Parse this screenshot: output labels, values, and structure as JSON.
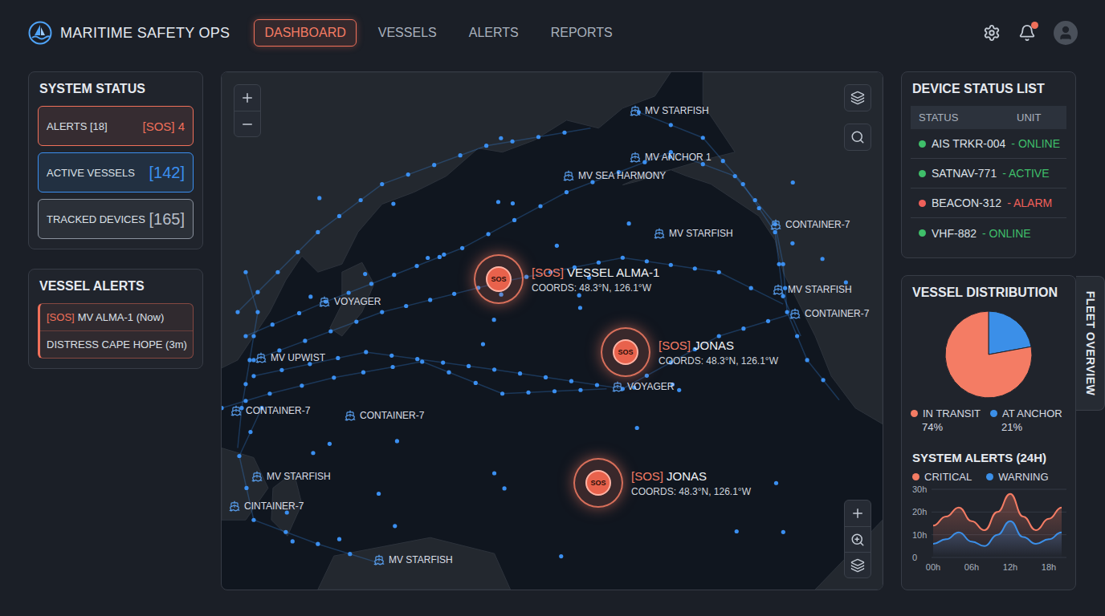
{
  "app": {
    "title": "MARITIME SAFETY OPS"
  },
  "nav": [
    {
      "label": "DASHBOARD",
      "selected": true
    },
    {
      "label": "VESSELS",
      "selected": false
    },
    {
      "label": "ALERTS",
      "selected": false
    },
    {
      "label": "REPORTS",
      "selected": false
    }
  ],
  "header": {
    "notifications_unread": true
  },
  "system_status": {
    "title": "SYSTEM STATUS",
    "items": [
      {
        "kind": "alert",
        "label": "ALERTS [18]",
        "value": "[SOS] 4",
        "color": "#f0705a"
      },
      {
        "kind": "count",
        "label": "ACTIVE VESSELS",
        "value": "[142]",
        "color": "#3b8ff0"
      },
      {
        "kind": "count",
        "label": "TRACKED DEVICES",
        "value": "[165]",
        "color": "#8a929e"
      }
    ]
  },
  "vessel_alerts": {
    "title": "VESSEL ALERTS",
    "items": [
      {
        "tag": "[SOS]",
        "text": "MV ALMA-1 (Now)"
      },
      {
        "text": "DISTRESS CAPE HOPE (3m)"
      }
    ]
  },
  "map": {
    "sos_markers": [
      {
        "icon": "SOS",
        "tag": "[SOS]",
        "name": "VESSEL ALMA-1",
        "coords": "COORDS: 48.3°N, 126.1°W"
      },
      {
        "icon": "SOS",
        "tag": "[SOS]",
        "name": "JONAS",
        "coords": "COORDS: 48.3°N, 126.1°W"
      },
      {
        "icon": "SOS",
        "tag": "[SOS]",
        "name": "JONAS",
        "coords": "COORDS: 48.3°N, 126.1°W"
      }
    ],
    "vessels": [
      {
        "name": "MV STARFISH"
      },
      {
        "name": "MV ANCHOR 1"
      },
      {
        "name": "MV SEA HARMONY"
      },
      {
        "name": "MV STARFISH"
      },
      {
        "name": "CONTAINER-7"
      },
      {
        "name": "MV STARFISH"
      },
      {
        "name": "CONTAINER-7"
      },
      {
        "name": "VOYAGER"
      },
      {
        "name": "MV UPWIST"
      },
      {
        "name": "VOYAGER"
      },
      {
        "name": "CONTAINER-7"
      },
      {
        "name": "CONTAINER-7"
      },
      {
        "name": "MV STARFISH"
      },
      {
        "name": "CINTAINER-7"
      },
      {
        "name": "MV STARFISH"
      }
    ]
  },
  "device_status": {
    "title": "DEVICE STATUS LIST",
    "columns": [
      "STATUS",
      "UNIT"
    ],
    "rows": [
      {
        "name": "AIS TRKR-004",
        "status": "- ONLINE",
        "color": "#3fbf6a"
      },
      {
        "name": "SATNAV-771",
        "status": "- ACTIVE",
        "color": "#3fbf6a"
      },
      {
        "name": "BEACON-312",
        "status": "- ALARM",
        "color": "#f0605a"
      },
      {
        "name": "VHF-882",
        "status": "- ONLINE",
        "color": "#3fbf6a"
      }
    ]
  },
  "vessel_distribution": {
    "title": "VESSEL DISTRIBUTION",
    "tab": "FLEET OVERVIEW",
    "series": [
      {
        "label": "IN TRANSIT",
        "reading": "74%",
        "value": 74,
        "color": "#f47c64"
      },
      {
        "label": "AT ANCHOR",
        "reading": "21%",
        "value": 21,
        "color": "#3b8fe8"
      }
    ]
  },
  "system_alerts": {
    "title": "SYSTEM ALERTS (24H)",
    "y_ticks": [
      "30h",
      "20h",
      "10h",
      "0"
    ],
    "x_ticks": [
      "00h",
      "06h",
      "12h",
      "18h"
    ],
    "series": [
      {
        "label": "CRITICAL",
        "color": "#f47c64",
        "values": [
          14,
          18,
          22,
          16,
          12,
          20,
          28,
          18,
          12,
          17,
          22
        ]
      },
      {
        "label": "WARNING",
        "color": "#3b8fe8",
        "values": [
          6,
          8,
          11,
          7,
          5,
          10,
          16,
          9,
          6,
          8,
          11
        ]
      }
    ]
  }
}
